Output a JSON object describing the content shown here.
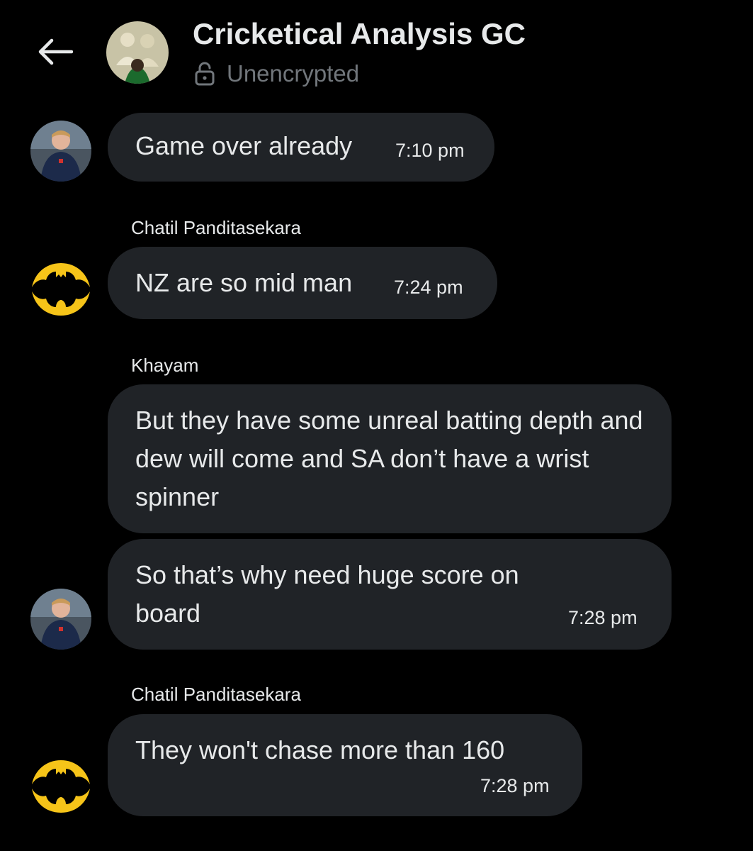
{
  "header": {
    "title": "Cricketical Analysis GC",
    "encryption_status": "Unencrypted",
    "back_icon": "arrow-left-icon",
    "lock_icon": "unlocked-padlock-icon"
  },
  "colors": {
    "background": "#000000",
    "bubble": "#202327",
    "text": "#e7e9ea",
    "muted": "#71767b"
  },
  "messages": [
    {
      "sender": "",
      "text": "Game over already",
      "time": "7:10 pm"
    },
    {
      "sender": "Chatil Panditasekara",
      "text": "NZ are so mid man",
      "time": "7:24 pm"
    },
    {
      "sender": "Khayam",
      "text": "But they have some unreal batting depth and dew will come and SA don’t have a wrist spinner",
      "time": ""
    },
    {
      "sender": "",
      "text": "So that’s why need huge score on board",
      "time": "7:28 pm"
    },
    {
      "sender": "Chatil Panditasekara",
      "text": "They won't chase more than 160",
      "time": "7:28 pm"
    }
  ]
}
